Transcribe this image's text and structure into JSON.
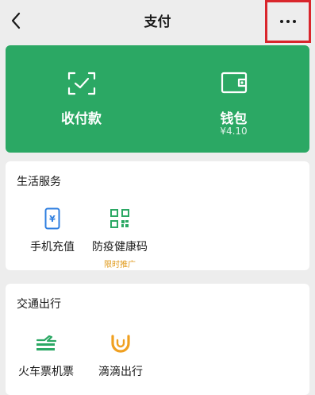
{
  "nav": {
    "title": "支付"
  },
  "wallet_panel": {
    "items": [
      {
        "label": "收付款",
        "sub": ""
      },
      {
        "label": "钱包",
        "sub": "¥4.10"
      }
    ]
  },
  "sections": [
    {
      "title": "生活服务",
      "items": [
        {
          "label": "手机充值",
          "icon": "phone-recharge-icon",
          "badge": ""
        },
        {
          "label": "防疫健康码",
          "icon": "qr-code-icon",
          "badge": "限时推广"
        }
      ]
    },
    {
      "title": "交通出行",
      "items": [
        {
          "label": "火车票机票",
          "icon": "train-flight-icon",
          "badge": ""
        },
        {
          "label": "滴滴出行",
          "icon": "didi-icon",
          "badge": ""
        }
      ]
    }
  ],
  "colors": {
    "accent_green": "#2ba864",
    "icon_blue": "#2f7fe0",
    "icon_orange": "#f0a020",
    "highlight_red": "#d9262c",
    "badge_orange": "#e09a1b"
  }
}
